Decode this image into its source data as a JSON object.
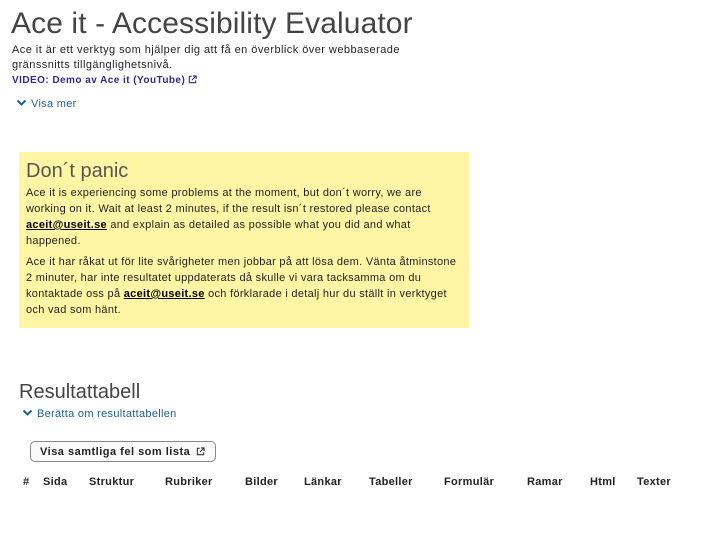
{
  "header": {
    "title": "Ace it - Accessibility Evaluator",
    "intro": "Ace it är ett verktyg som hjälper dig att få en överblick över webbaserade gränssnitts tillgänglighetsnivå.",
    "video_link": "VIDEO: Demo av Ace it (YouTube)",
    "show_more": "Visa mer"
  },
  "notice": {
    "title": "Don´t panic",
    "en_before": "Ace it is experiencing some problems at the moment, but don´t worry, we are working on it. Wait at least 2 minutes, if the result isn´t restored please contact ",
    "en_email": "aceit@useit.se",
    "en_after": " and explain as detailed as possible what you did and what happened.",
    "sv_before": "Ace it har råkat ut för lite svårigheter men jobbar på att lösa dem. Vänta åtminstone 2 minuter, har inte resultatet uppdaterats då skulle vi vara tacksamma om du kontaktade oss på ",
    "sv_email": "aceit@useit.se",
    "sv_after": " och förklarade i detalj hur du ställt in verktyget och vad som hänt.",
    "background_color": "#fff5a5"
  },
  "results": {
    "title": "Resultattabell",
    "about_toggle": "Berätta om resultattabellen",
    "list_button": "Visa samtliga fel som lista",
    "columns": [
      "#",
      "Sida",
      "Struktur",
      "Rubriker",
      "Bilder",
      "Länkar",
      "Tabeller",
      "Formulär",
      "Ramar",
      "Html",
      "Texter"
    ]
  },
  "icons": {
    "external": "external-link-icon",
    "chevron": "chevron-down-icon"
  },
  "colors": {
    "link": "#1f5f8b",
    "video_link": "#2e2a8a",
    "notice_bg": "#fff5a5"
  }
}
